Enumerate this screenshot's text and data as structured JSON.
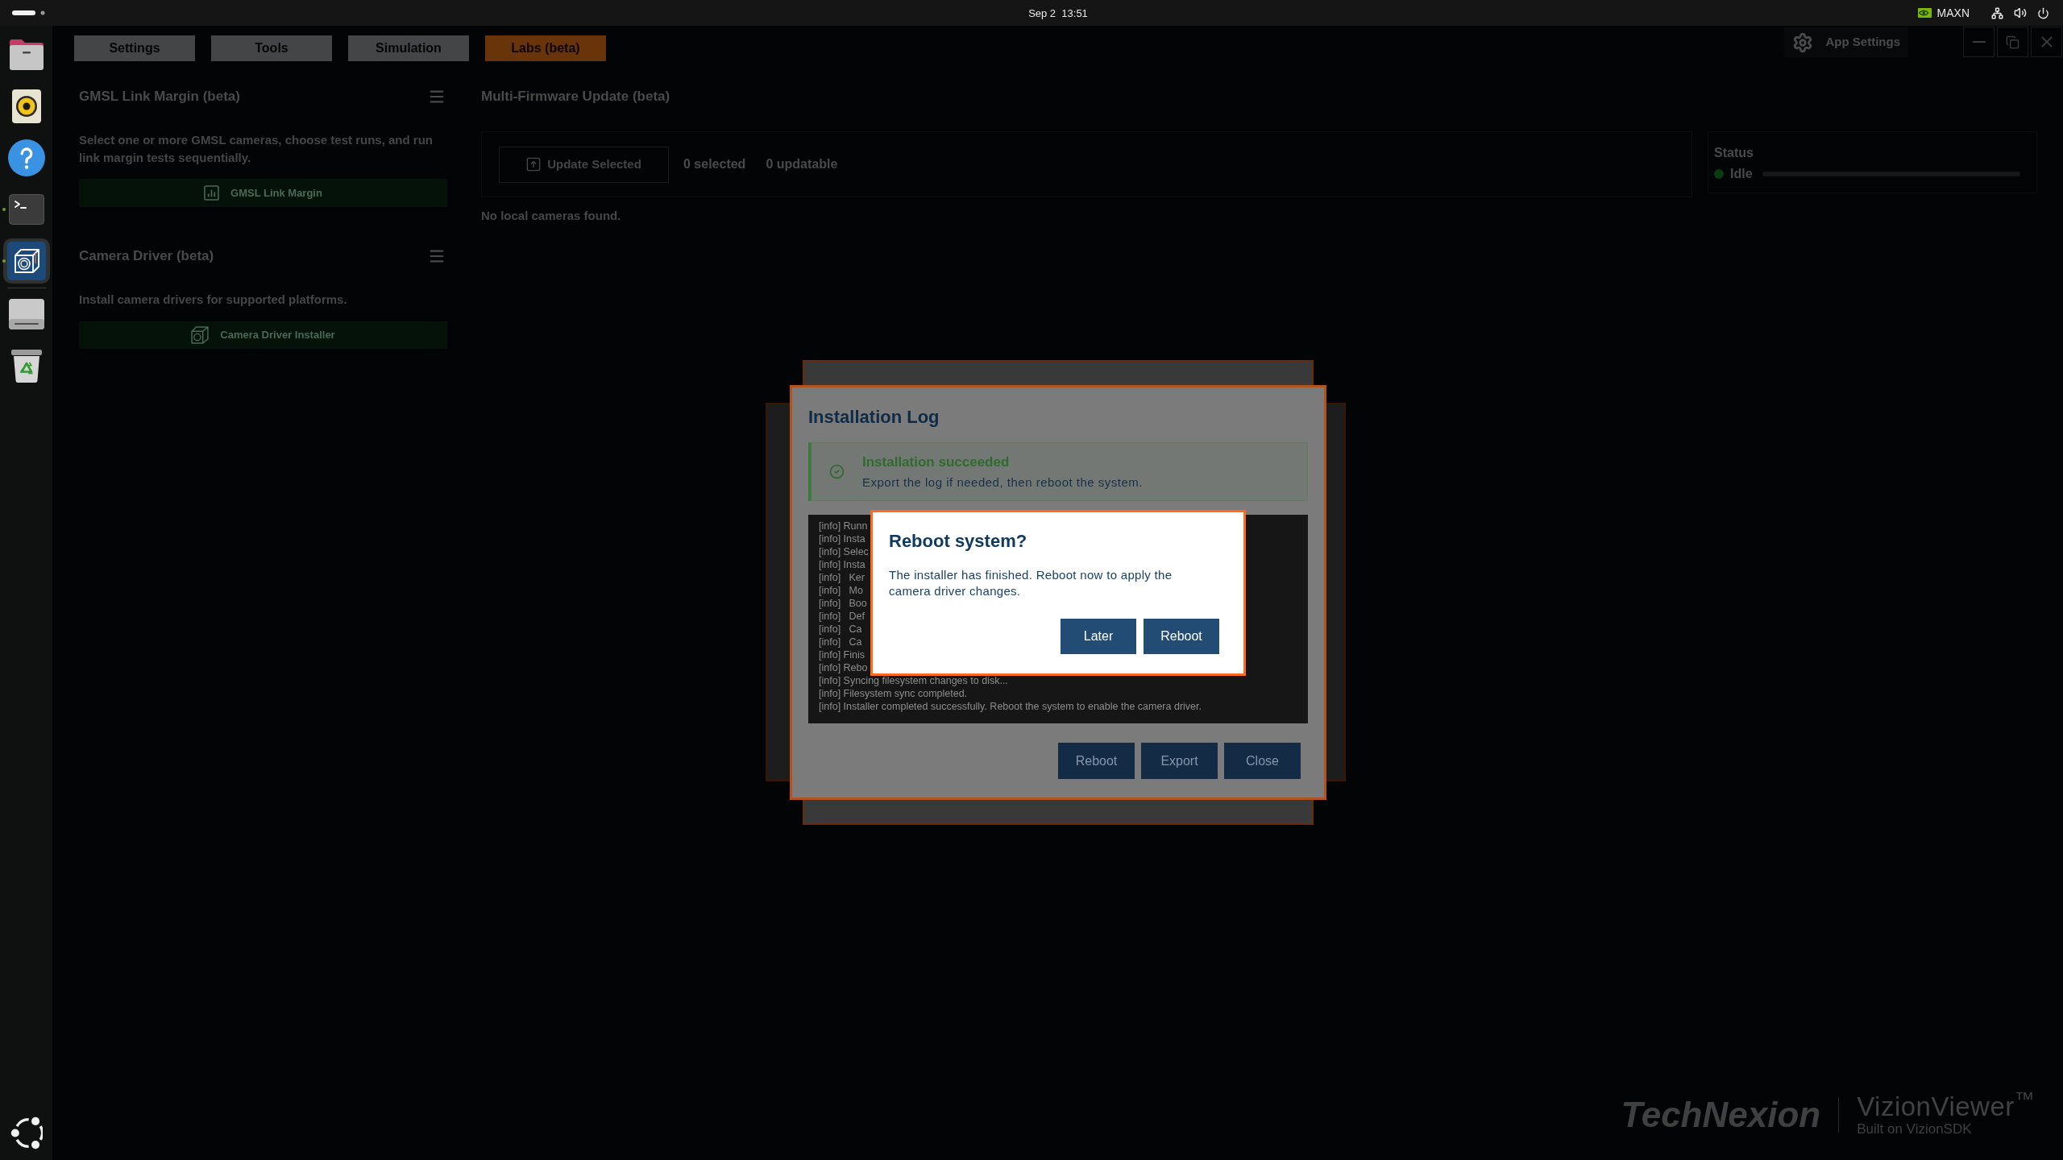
{
  "top_bar": {
    "clock": "Sep 2  13:51",
    "power_mode": "MAXN"
  },
  "dock": {
    "apps": [
      {
        "kind": "files",
        "running": false,
        "selected": false
      },
      {
        "kind": "music",
        "running": false,
        "selected": false
      },
      {
        "kind": "help",
        "running": false,
        "selected": false
      },
      {
        "kind": "terminal",
        "running": true,
        "selected": false
      },
      {
        "kind": "camera",
        "running": true,
        "selected": true
      }
    ],
    "devices": [
      {
        "kind": "drive"
      },
      {
        "kind": "trash"
      }
    ]
  },
  "app": {
    "tabs": [
      {
        "label": "Settings",
        "selected": false
      },
      {
        "label": "Tools",
        "selected": false
      },
      {
        "label": "Simulation",
        "selected": false
      },
      {
        "label": "Labs (beta)",
        "selected": true
      }
    ],
    "settings_button": "App Settings",
    "panels": [
      {
        "title": "GMSL Link Margin (beta)",
        "description": "Select one or more GMSL cameras, choose test runs, and run link margin tests sequentially.",
        "action": "GMSL Link Margin"
      },
      {
        "title": "Camera Driver (beta)",
        "description": "Install camera drivers for supported platforms.",
        "action": "Camera Driver Installer"
      }
    ],
    "firmware_update": {
      "title": "Multi-Firmware Update (beta)",
      "update_button": "Update Selected",
      "selected_count": "0 selected",
      "updatable_count": "0 updatable",
      "empty_message": "No local cameras found.",
      "status": {
        "label": "Status",
        "state": "Idle"
      }
    },
    "logo": {
      "brand": "TechNexion",
      "product": "VizionViewer$^{™}$",
      "tagline": "Built on VizionSDK"
    }
  },
  "installation_log": {
    "title": "Installation Log",
    "banner": {
      "kind": "success",
      "title": "Installation succeeded",
      "message": "Export the log if needed, then reboot the system."
    },
    "lines": [
      "[info] Runn",
      "[info] Insta",
      "[info] Selec",
      "[info] Insta",
      "[info]   Ker",
      "[info]   Mo",
      "[info]   Boo",
      "[info]   Def",
      "[info]   Ca",
      "[info]   Ca",
      "[info] Finis",
      "[info] Rebo",
      "[info] Syncing filesystem changes to disk...",
      "[info] Filesystem sync completed.",
      "[info] Installer completed successfully. Reboot the system to enable the camera driver."
    ],
    "buttons": [
      "Reboot",
      "Export",
      "Close"
    ]
  },
  "reboot_dialog": {
    "title": "Reboot system?",
    "message": "The installer has finished. Reboot now to apply the camera driver changes.",
    "buttons": [
      "Later",
      "Reboot"
    ]
  }
}
